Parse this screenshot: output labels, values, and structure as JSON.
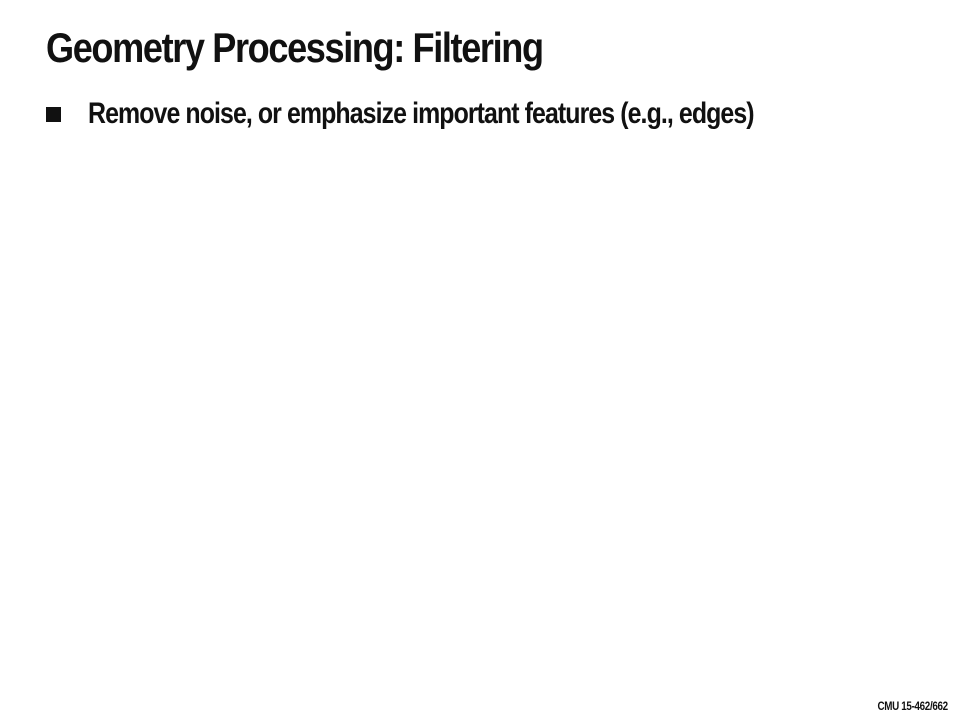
{
  "slide": {
    "title": "Geometry Processing: Filtering",
    "bullets": [
      {
        "text": "Remove noise, or emphasize important features (e.g., edges)"
      }
    ],
    "footer": "CMU 15-462/662"
  }
}
